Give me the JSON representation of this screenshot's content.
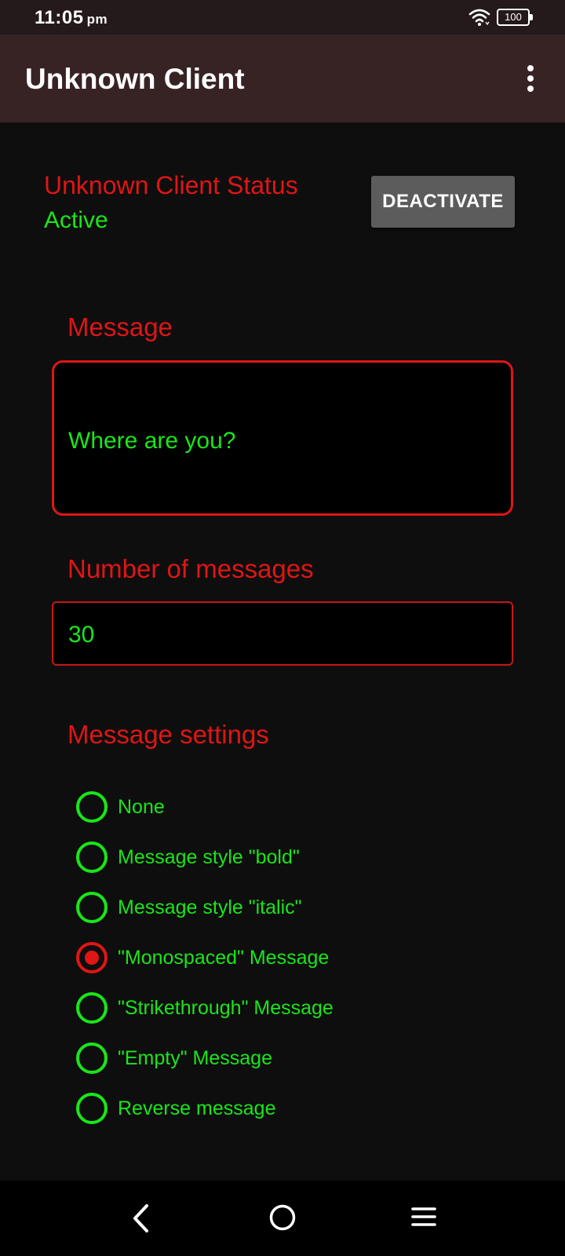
{
  "status_bar": {
    "time": "11:05",
    "ampm": "pm",
    "battery": "100",
    "icons": [
      "wifi-icon",
      "battery-icon"
    ]
  },
  "app_bar": {
    "title": "Unknown Client",
    "menu_icon": "more-vert-icon"
  },
  "client_status": {
    "title": "Unknown Client Status",
    "value": "Active",
    "button_label": "DEACTIVATE"
  },
  "message": {
    "label": "Message",
    "value": "Where are you?"
  },
  "count": {
    "label": "Number of messages",
    "value": "30"
  },
  "settings": {
    "label": "Message settings",
    "options": [
      {
        "label": "None",
        "selected": false
      },
      {
        "label": "Message style \"bold\"",
        "selected": false
      },
      {
        "label": "Message style \"italic\"",
        "selected": false
      },
      {
        "label": "\"Monospaced\" Message",
        "selected": true
      },
      {
        "label": "\"Strikethrough\" Message",
        "selected": false
      },
      {
        "label": "\"Empty\" Message",
        "selected": false
      },
      {
        "label": "Reverse message",
        "selected": false
      }
    ]
  },
  "nav_bar": {
    "icons": [
      "back-icon",
      "home-icon",
      "recents-icon"
    ]
  },
  "colors": {
    "accent_red": "#e01515",
    "accent_green": "#19e619",
    "app_bar": "#382324",
    "background": "#0e0e0e"
  }
}
